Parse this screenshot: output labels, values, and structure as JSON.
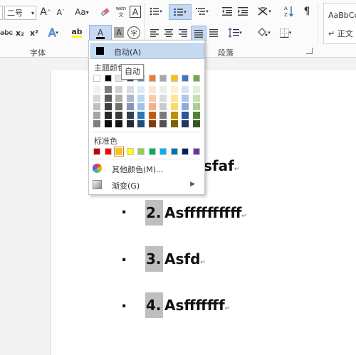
{
  "ribbon": {
    "font_size": "二号",
    "grow_font": "A",
    "shrink_font": "A",
    "change_case": "Aa",
    "clear_format": "",
    "phonetic": "wén 文",
    "char_border": "A",
    "row2": {
      "abc": "abc",
      "subscript": "x₂",
      "superscript": "x²",
      "text_effect": "A",
      "highlight": "ab",
      "font_color": "A",
      "char_shading": "A",
      "enclose": "字"
    },
    "styles_preview": "AaBbCcI",
    "styles_name": "↵ 正文",
    "group_font": "字体",
    "group_paragraph": "段落"
  },
  "color_menu": {
    "auto_label": "自动(A)",
    "theme_header": "主题颜色",
    "standard_header": "标准色",
    "more_colors": "其他颜色(M)...",
    "gradient": "渐变(G)",
    "tooltip": "自动",
    "theme_top": [
      "#ffffff",
      "#000000",
      "#e7e6e6",
      "#44546a",
      "#5b9bd5",
      "#ed7d31",
      "#a5a5a5",
      "#ffc000",
      "#4472c4",
      "#70ad47"
    ],
    "theme_shades": [
      [
        "#f2f2f2",
        "#7f7f7f",
        "#d0cece",
        "#d6dce4",
        "#deebf6",
        "#fbe5d5",
        "#ededed",
        "#fff2cc",
        "#dae3f3",
        "#e2efd9"
      ],
      [
        "#d8d8d8",
        "#595959",
        "#aeabab",
        "#adb9ca",
        "#bdd7ee",
        "#f7cbac",
        "#dbdbdb",
        "#fee599",
        "#b4c6e7",
        "#c5e0b3"
      ],
      [
        "#bfbfbf",
        "#3f3f3f",
        "#757070",
        "#8496b0",
        "#9dc3e6",
        "#f4b183",
        "#c9c9c9",
        "#ffd965",
        "#8eaadb",
        "#a8d08d"
      ],
      [
        "#a5a5a5",
        "#262626",
        "#3a3838",
        "#323f4f",
        "#2e75b5",
        "#c55a11",
        "#7b7b7b",
        "#bf9000",
        "#2f5496",
        "#538135"
      ],
      [
        "#7f7f7f",
        "#0c0c0c",
        "#171616",
        "#222a35",
        "#1e4e79",
        "#843c0b",
        "#525252",
        "#7f6000",
        "#1f3864",
        "#375623"
      ]
    ],
    "standard": [
      "#c00000",
      "#ff0000",
      "#ffc000",
      "#ffff00",
      "#92d050",
      "#00b050",
      "#00b0f0",
      "#0070c0",
      "#002060",
      "#7030a0"
    ]
  },
  "document": {
    "items": [
      {
        "bullet": ".",
        "num": "",
        "text": "sfaf",
        "mark": "↵"
      },
      {
        "bullet": ".",
        "num": "2.",
        "text": "Asffffffffff",
        "mark": "↵"
      },
      {
        "bullet": ".",
        "num": "3.",
        "text": "Asfd",
        "mark": "↵"
      },
      {
        "bullet": ".",
        "num": "4.",
        "text": "Asfffffff",
        "mark": "↵"
      }
    ]
  }
}
